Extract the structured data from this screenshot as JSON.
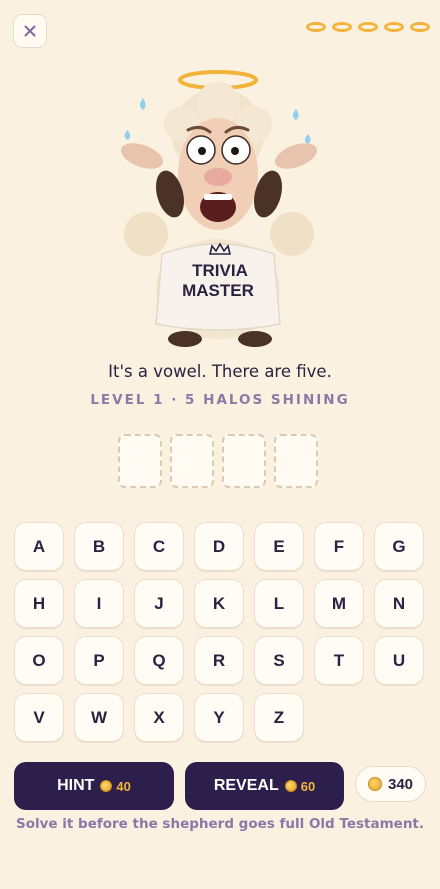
{
  "header": {
    "close_icon": "close-icon",
    "halos": {
      "count": 5,
      "icon": "halo-icon",
      "color": "#f2b33a"
    }
  },
  "hero": {
    "illustration": "worried-sheep-with-halo",
    "shirt_text": "TRIVIA MASTER"
  },
  "puzzle": {
    "clue": "It's a vowel. There are five.",
    "level_text": "LEVEL 1 · 5 HALOS SHINING",
    "answer_slots": 4
  },
  "keyboard": {
    "rows": [
      [
        "A",
        "B",
        "C",
        "D",
        "E",
        "F",
        "G"
      ],
      [
        "H",
        "I",
        "J",
        "K",
        "L",
        "M",
        "N"
      ],
      [
        "O",
        "P",
        "Q",
        "R",
        "S",
        "T",
        "U"
      ],
      [
        "V",
        "W",
        "X",
        "Y",
        "Z"
      ]
    ]
  },
  "actions": {
    "hint_label": "HINT",
    "hint_cost": "40",
    "reveal_label": "REVEAL",
    "reveal_cost": "60",
    "coin_balance": "340"
  },
  "footer_text": "Solve it before the shepherd goes full Old Testament.",
  "colors": {
    "background": "#fbf1e1",
    "accent": "#2d1f4c",
    "gold": "#f2b33a",
    "muted": "#8c7aa6"
  }
}
